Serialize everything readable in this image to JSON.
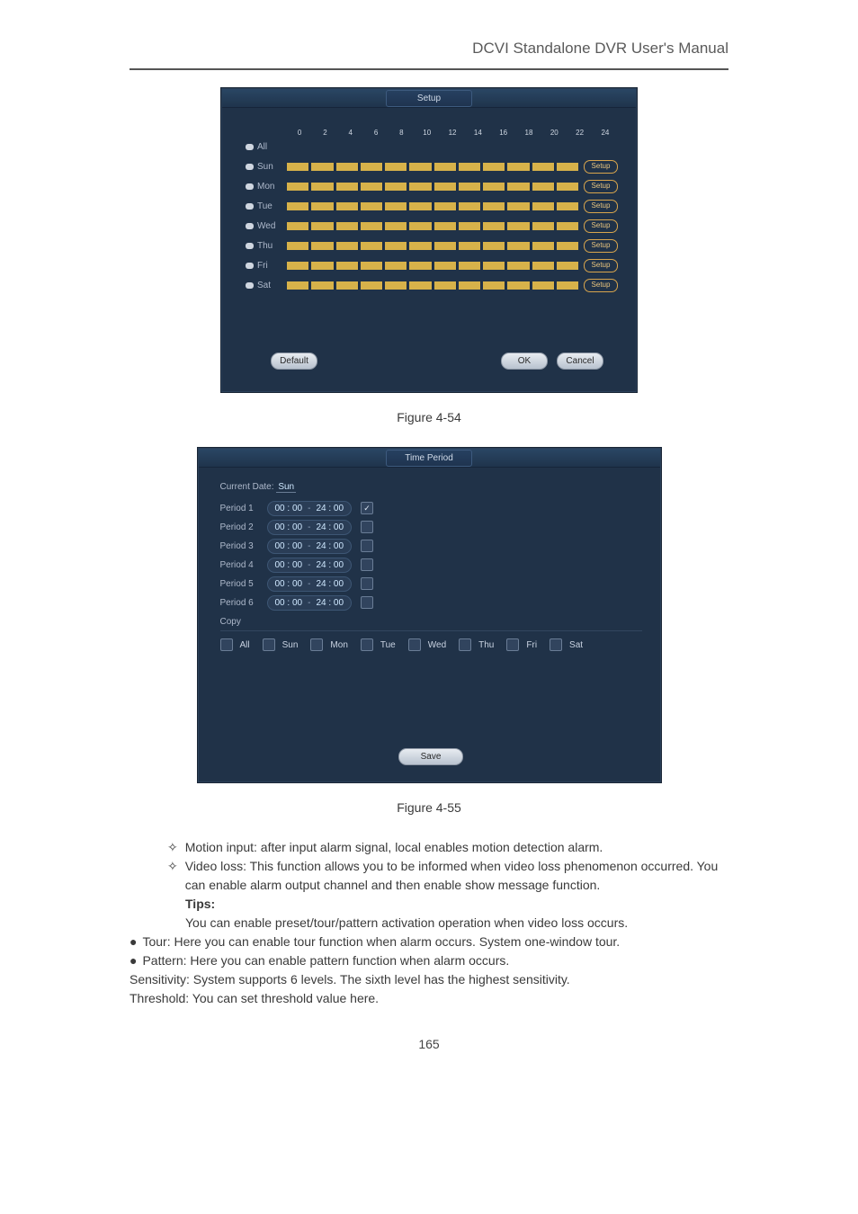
{
  "header": {
    "title": "DCVI Standalone DVR User's Manual"
  },
  "setup": {
    "title": "Setup",
    "ticks": [
      "0",
      "2",
      "4",
      "6",
      "8",
      "10",
      "12",
      "14",
      "16",
      "18",
      "20",
      "22",
      "24"
    ],
    "rows": [
      {
        "label": "All",
        "has_bar": false,
        "setup": ""
      },
      {
        "label": "Sun",
        "has_bar": true,
        "setup": "Setup"
      },
      {
        "label": "Mon",
        "has_bar": true,
        "setup": "Setup"
      },
      {
        "label": "Tue",
        "has_bar": true,
        "setup": "Setup"
      },
      {
        "label": "Wed",
        "has_bar": true,
        "setup": "Setup"
      },
      {
        "label": "Thu",
        "has_bar": true,
        "setup": "Setup"
      },
      {
        "label": "Fri",
        "has_bar": true,
        "setup": "Setup"
      },
      {
        "label": "Sat",
        "has_bar": true,
        "setup": "Setup"
      }
    ],
    "buttons": {
      "default": "Default",
      "ok": "OK",
      "cancel": "Cancel"
    }
  },
  "fig1": "Figure 4-54",
  "tp": {
    "title": "Time Period",
    "current_label": "Current Date:",
    "current_day": "Sun",
    "periods": [
      {
        "label": "Period 1",
        "start": "00 : 00",
        "end": "24 : 00",
        "on": true
      },
      {
        "label": "Period 2",
        "start": "00 : 00",
        "end": "24 : 00",
        "on": false
      },
      {
        "label": "Period 3",
        "start": "00 : 00",
        "end": "24 : 00",
        "on": false
      },
      {
        "label": "Period 4",
        "start": "00 : 00",
        "end": "24 : 00",
        "on": false
      },
      {
        "label": "Period 5",
        "start": "00 : 00",
        "end": "24 : 00",
        "on": false
      },
      {
        "label": "Period 6",
        "start": "00 : 00",
        "end": "24 : 00",
        "on": false
      }
    ],
    "copy_label": "Copy",
    "copy_days": [
      "All",
      "Sun",
      "Mon",
      "Tue",
      "Wed",
      "Thu",
      "Fri",
      "Sat"
    ],
    "save": "Save"
  },
  "fig2": "Figure 4-55",
  "bullets": {
    "motion": "Motion input: after input alarm signal, local enables motion detection alarm.",
    "vloss": "Video loss: This function allows you to be informed when video loss phenomenon occurred. You can enable alarm output channel and then enable show message function.",
    "tips_h": "Tips:",
    "tips_b": "You can enable preset/tour/pattern activation operation when video loss occurs.",
    "tour": "Tour: Here you can enable tour function when alarm occurs. System one-window tour.",
    "pattern": "Pattern: Here you can enable pattern function when alarm occurs.",
    "sens": "Sensitivity: System supports 6 levels. The sixth level has the highest sensitivity.",
    "th": "Threshold: You can set threshold value here."
  },
  "pgnum": "165"
}
